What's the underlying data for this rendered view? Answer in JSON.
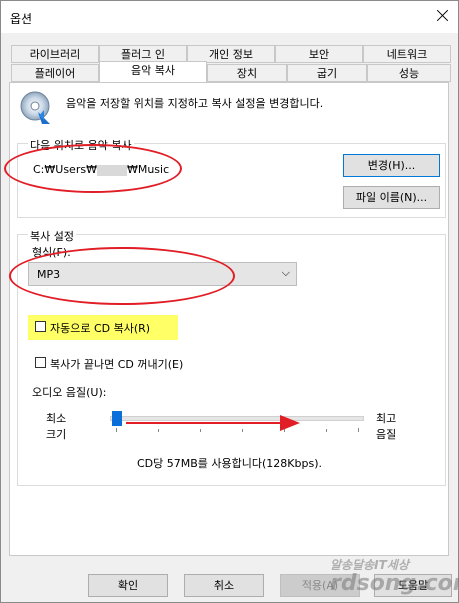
{
  "window": {
    "title": "옵션"
  },
  "tabs": {
    "row_top": [
      "라이브러리",
      "플러그 인",
      "개인 정보",
      "보안",
      "네트워크"
    ],
    "row_bottom": [
      "플레이어",
      "음악 복사",
      "장치",
      "굽기",
      "성능"
    ],
    "active": "음악 복사"
  },
  "header": {
    "description": "음악을 저장할 위치를 지정하고 복사 설정을 변경합니다.",
    "icon": "cd-rip-icon"
  },
  "location": {
    "group_title": "다음 위치로 음악 복사",
    "path_start": "C:₩Users₩",
    "path_end": "₩Music",
    "change_button": "변경(H)...",
    "filename_button": "파일 이름(N)..."
  },
  "rip_settings": {
    "group_title": "복사 설정",
    "format_label": "형식(F):",
    "format_value": "MP3",
    "auto_rip_label": "자동으로 CD 복사(R)",
    "auto_rip_checked": false,
    "eject_label": "복사가 끝나면 CD 꺼내기(E)",
    "eject_checked": false,
    "quality_label": "오디오 음질(U):",
    "min_label_1": "최소",
    "min_label_2": "크기",
    "max_label_1": "최고",
    "max_label_2": "음질",
    "slider_level": 0,
    "usage_text": "CD당 57MB를 사용합니다(128Kbps)."
  },
  "buttons": {
    "ok": "확인",
    "cancel": "취소",
    "apply": "적용(A)",
    "help": "도움말"
  },
  "watermark": {
    "line1": "알송달송IT세상",
    "line2": "rdsong.com"
  },
  "colors": {
    "annotation_red": "#e11d25",
    "highlight_yellow": "#ffff66",
    "slider_thumb": "#0a6fd8"
  }
}
